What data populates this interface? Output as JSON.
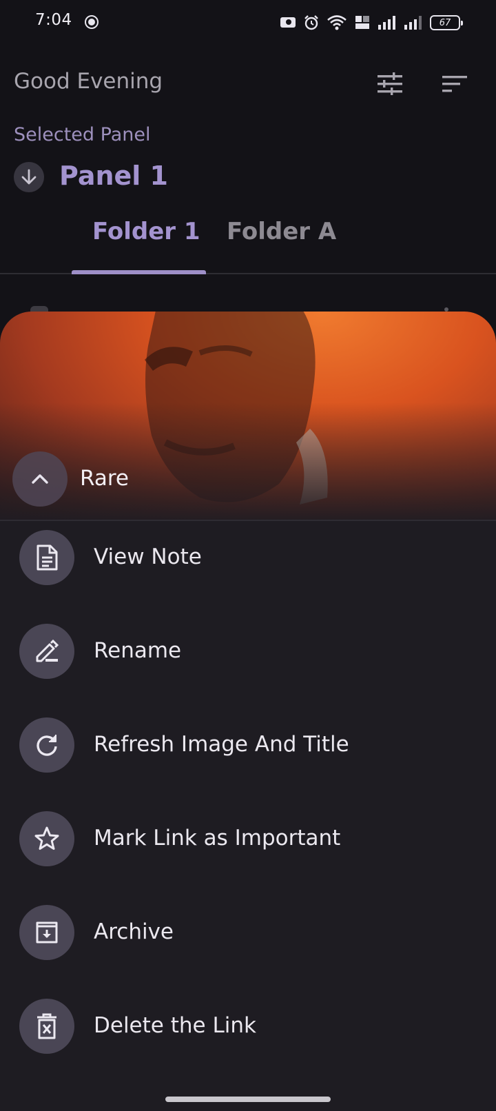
{
  "status_bar": {
    "time": "7:04",
    "battery": "67",
    "icons": [
      "notification-face-icon",
      "message-icon",
      "alarm-icon",
      "wifi-icon",
      "volte-icon",
      "signal-1-icon",
      "signal-2-icon",
      "battery-icon"
    ]
  },
  "header": {
    "greeting": "Good Evening",
    "tune_icon": "tune-icon",
    "sort_icon": "sort-icon"
  },
  "panel": {
    "selected_label": "Selected Panel",
    "name": "Panel 1"
  },
  "tabs": [
    {
      "label": "Folder 1",
      "active": true
    },
    {
      "label": "Folder A",
      "active": false
    }
  ],
  "sheet": {
    "title": "Rare",
    "menu": [
      {
        "label": "View Note",
        "icon": "note-icon"
      },
      {
        "label": "Rename",
        "icon": "edit-icon"
      },
      {
        "label": "Refresh Image And Title",
        "icon": "refresh-icon"
      },
      {
        "label": "Mark Link as Important",
        "icon": "star-icon"
      },
      {
        "label": "Archive",
        "icon": "archive-icon"
      },
      {
        "label": "Delete the Link",
        "icon": "delete-icon"
      }
    ]
  },
  "colors": {
    "background": "#131217",
    "accent": "#a393cf",
    "sheet": "#1e1c22",
    "icon_circle": "#4a4655"
  }
}
